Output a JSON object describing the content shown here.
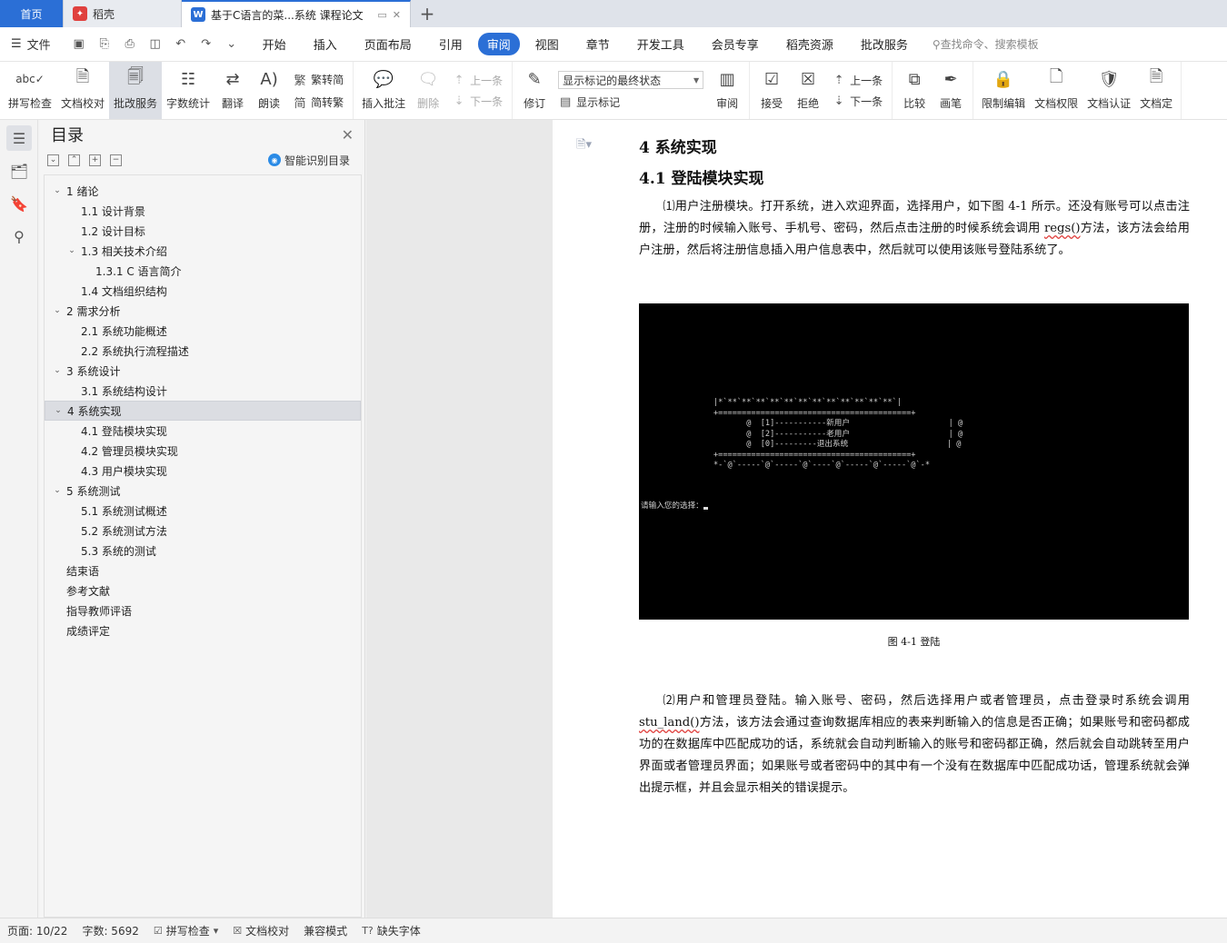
{
  "tabs": {
    "home": "首页",
    "daoke": "稻壳",
    "doc_title": "基于C语言的菜...系统 课程论文",
    "add": "+"
  },
  "menu": {
    "file": "文件",
    "tabs": [
      "开始",
      "插入",
      "页面布局",
      "引用",
      "审阅",
      "视图",
      "章节",
      "开发工具",
      "会员专享",
      "稻壳资源",
      "批改服务"
    ],
    "active_tab": "审阅",
    "search_placeholder": "查找命令、搜索模板"
  },
  "ribbon": {
    "spell_check": "拼写检查",
    "doc_proof": "文档校对",
    "review_service": "批改服务",
    "word_count": "字数统计",
    "translate": "翻译",
    "read_aloud": "朗读",
    "trad_to_simp": "繁转简",
    "simp_to_trad": "简转繁",
    "insert_comment": "插入批注",
    "delete": "删除",
    "prev_comment": "上一条",
    "next_comment": "下一条",
    "track_changes": "修订",
    "markup_state": "显示标记的最终状态",
    "show_markup": "显示标记",
    "review_pane": "审阅",
    "accept": "接受",
    "reject": "拒绝",
    "prev_change": "上一条",
    "next_change": "下一条",
    "compare": "比较",
    "ink": "画笔",
    "restrict_edit": "限制编辑",
    "doc_permission": "文档权限",
    "doc_certify": "文档认证",
    "doc_more": "文档定"
  },
  "toc": {
    "title": "目录",
    "smart_label": "智能识别目录",
    "items": [
      {
        "label": "1  绪论",
        "level": 1,
        "expand": true
      },
      {
        "label": "1.1  设计背景",
        "level": 2
      },
      {
        "label": "1.2  设计目标",
        "level": 2
      },
      {
        "label": "1.3 相关技术介绍",
        "level": 2,
        "expand": true
      },
      {
        "label": "1.3.1 C 语言简介",
        "level": 3
      },
      {
        "label": "1.4  文档组织结构",
        "level": 2
      },
      {
        "label": "2  需求分析",
        "level": 1,
        "expand": true
      },
      {
        "label": "2.1  系统功能概述",
        "level": 2
      },
      {
        "label": "2.2  系统执行流程描述",
        "level": 2
      },
      {
        "label": "3  系统设计",
        "level": 1,
        "expand": true
      },
      {
        "label": "3.1   系统结构设计",
        "level": 2
      },
      {
        "label": "4  系统实现",
        "level": 1,
        "expand": true,
        "selected": true
      },
      {
        "label": "4.1   登陆模块实现",
        "level": 2
      },
      {
        "label": "4.2  管理员模块实现",
        "level": 2
      },
      {
        "label": "4.3  用户模块实现",
        "level": 2
      },
      {
        "label": "5  系统测试",
        "level": 1,
        "expand": true
      },
      {
        "label": "5.1   系统测试概述",
        "level": 2
      },
      {
        "label": "5.2   系统测试方法",
        "level": 2
      },
      {
        "label": "5.3   系统的测试",
        "level": 2
      },
      {
        "label": "结束语",
        "level": 1
      },
      {
        "label": "参考文献",
        "level": 1
      },
      {
        "label": "指导教师评语",
        "level": 1
      },
      {
        "label": "成绩评定",
        "level": 1
      }
    ]
  },
  "document": {
    "h1": "4  系统实现",
    "h2": "4.1  登陆模块实现",
    "para1_a": "⑴用户注册模块。打开系统，进入欢迎界面，选择用户，如下图 4-1 所示。还没有账号可以点击注册，注册的时候输入账号、手机号、密码，然后点击注册的时候系统会调用 ",
    "para1_code": "regs()",
    "para1_b": "方法，该方法会给用户注册，然后将注册信息插入用户信息表中，然后就可以使用该账号登陆系统了。",
    "terminal_lines": [
      "|*`**`**`**`**`**`**`**`**`**`**`**`**`|",
      "+=========================================+",
      "       @  [1]-----------新用户                     | @",
      "       @  [2]-----------老用户                     | @",
      "       @  [0]---------退出系统                     | @",
      "+=========================================+",
      "*-`@`-----`@`-----`@`----`@`-----`@`-----`@`-*"
    ],
    "terminal_prompt": "请输入您的选择：",
    "caption": "图 4-1  登陆",
    "para2_a": "⑵用户和管理员登陆。输入账号、密码，然后选择用户或者管理员，点击登录时系统会调用 ",
    "para2_code": "stu_land()",
    "para2_b": "方法，该方法会通过查询数据库相应的表来判断输入的信息是否正确；如果账号和密码都成功的在数据库中匹配成功的话，系统就会自动判断输入的账号和密码都正确，然后就会自动跳转至用户界面或者管理员界面；如果账号或者密码中的其中有一个没有在数据库中匹配成功话，管理系统就会弹出提示框，并且会显示相关的错误提示。"
  },
  "status": {
    "page": "页面: 10/22",
    "words": "字数: 5692",
    "spell": "拼写检查",
    "proof": "文档校对",
    "compat": "兼容模式",
    "missing_font": "缺失字体"
  },
  "colors": {
    "accent": "#2b6fd6",
    "spell_error": "#e0413e"
  }
}
